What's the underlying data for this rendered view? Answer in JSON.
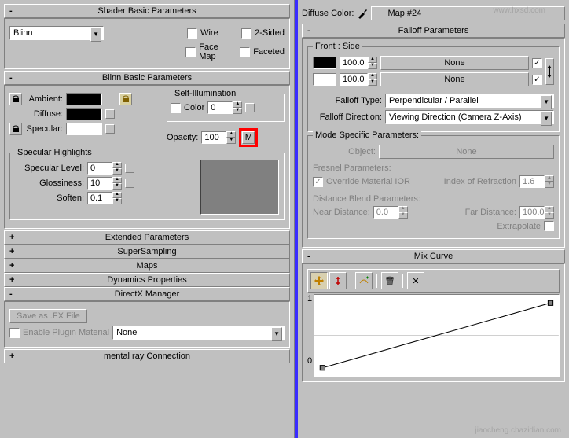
{
  "left": {
    "shader_basic": {
      "title": "Shader Basic Parameters",
      "shader": "Blinn",
      "wire": "Wire",
      "two_sided": "2-Sided",
      "face_map": "Face Map",
      "faceted": "Faceted"
    },
    "blinn_basic": {
      "title": "Blinn Basic Parameters",
      "ambient": "Ambient:",
      "diffuse": "Diffuse:",
      "specular": "Specular:",
      "self_illum": "Self-Illumination",
      "color_label": "Color",
      "color_val": "0",
      "opacity_label": "Opacity:",
      "opacity_val": "100",
      "m_btn": "M"
    },
    "spec_highlights": {
      "title": "Specular Highlights",
      "spec_level": "Specular Level:",
      "spec_level_val": "0",
      "glossiness": "Glossiness:",
      "glossiness_val": "10",
      "soften": "Soften:",
      "soften_val": "0.1"
    },
    "rollouts": {
      "extended": "Extended Parameters",
      "supersampling": "SuperSampling",
      "maps": "Maps",
      "dynamics": "Dynamics Properties",
      "directx": "DirectX Manager",
      "mentalray": "mental ray Connection"
    },
    "directx": {
      "save_fx": "Save as .FX File",
      "enable_plugin": "Enable Plugin Material",
      "plugin_value": "None"
    },
    "plus": "+",
    "minus": "-"
  },
  "right": {
    "header": {
      "diffuse_color": "Diffuse Color:",
      "map_name": "Map #24"
    },
    "falloff": {
      "title": "Falloff Parameters",
      "front_side": "Front : Side",
      "val1": "100.0",
      "val2": "100.0",
      "none": "None",
      "falloff_type": "Falloff Type:",
      "falloff_type_val": "Perpendicular / Parallel",
      "falloff_dir": "Falloff Direction:",
      "falloff_dir_val": "Viewing Direction (Camera Z-Axis)",
      "theta": "↔"
    },
    "mode": {
      "title": "Mode Specific Parameters:",
      "object": "Object:",
      "object_val": "None",
      "fresnel": "Fresnel Parameters:",
      "override": "Override Material IOR",
      "ior_label": "Index of Refraction",
      "ior_val": "1.6",
      "distance": "Distance Blend Parameters:",
      "near": "Near Distance:",
      "near_val": "0.0",
      "far": "Far Distance:",
      "far_val": "100.0",
      "extrapolate": "Extrapolate"
    },
    "mix_curve": {
      "title": "Mix Curve",
      "y1": "1",
      "y0": "0"
    }
  },
  "watermarks": {
    "top": "www.hxsd.com",
    "bottom": "jiaocheng.chazidian.com"
  },
  "chart_data": {
    "type": "line",
    "title": "Mix Curve",
    "x": [
      0,
      1
    ],
    "values": [
      0,
      1
    ],
    "xlabel": "",
    "ylabel": "",
    "ylim": [
      0,
      1
    ],
    "xlim": [
      0,
      1
    ]
  }
}
